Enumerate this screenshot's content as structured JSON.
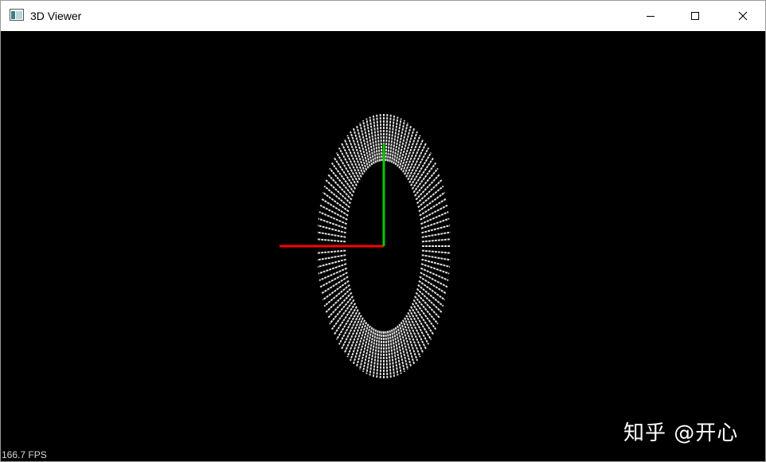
{
  "window": {
    "title": "3D Viewer",
    "icons": {
      "app": "viewer-app-icon",
      "minimize": "minimize-icon",
      "maximize": "maximize-icon",
      "close": "close-icon"
    }
  },
  "viewport": {
    "background": "#000000",
    "fps_label": "166.7 FPS",
    "watermark": "知乎 @开心",
    "axis_colors": {
      "x": "#ff0000",
      "y": "#00cc00",
      "mesh": "#e0e0e0"
    }
  }
}
